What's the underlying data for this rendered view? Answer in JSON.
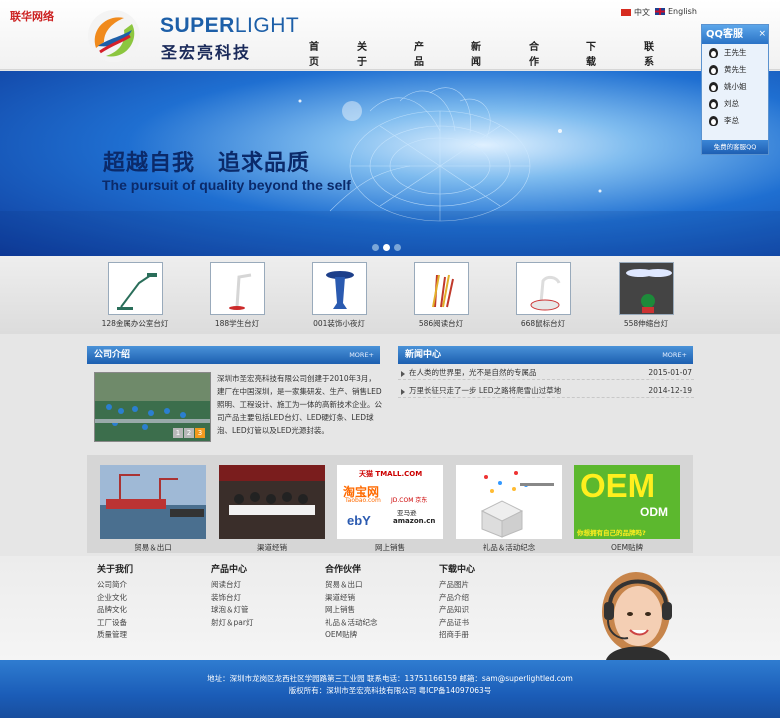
{
  "watermark": "联华网络",
  "brand": {
    "en_bold": "SUPER",
    "en_light": "LIGHT",
    "cn": "圣宏亮科技"
  },
  "lang": {
    "cn": "中文",
    "en": "English"
  },
  "nav": [
    "首页",
    "关于我们",
    "产品中心",
    "新闻中心",
    "合作伙伴",
    "下载中心",
    "联系我们"
  ],
  "banner": {
    "cn": "超越自我　追求品质",
    "en": "The pursuit of quality beyond the self"
  },
  "products": [
    {
      "caption": "128金属办公室台灯"
    },
    {
      "caption": "188学生台灯"
    },
    {
      "caption": "001装饰小夜灯"
    },
    {
      "caption": "586阅读台灯"
    },
    {
      "caption": "668鼠标台灯"
    },
    {
      "caption": "558伸缩台灯"
    }
  ],
  "about": {
    "title": "公司介绍",
    "more": "MORE+",
    "text": "深圳市圣宏亮科技有限公司创建于2010年3月，建厂在中国深圳，是一家集研发、生产、销售LED照明、工程设计、施工为一体的高新技术企业。公司产品主要包括LED台灯、LED硬灯条、LED球泡、LED灯管以及LED光源封装。",
    "pages": [
      "1",
      "2",
      "3"
    ]
  },
  "news": {
    "title": "新闻中心",
    "more": "MORE+",
    "items": [
      {
        "text": "在人类的世界里，光不是自然的专属品",
        "date": "2015-01-07"
      },
      {
        "text": "万里长征只走了一步 LED之路将爬雪山过草地",
        "date": "2014-12-19"
      }
    ]
  },
  "business": [
    {
      "caption": "贸易＆出口"
    },
    {
      "caption": "渠道经销"
    },
    {
      "caption": "网上销售",
      "logos": [
        "天猫 TMALL.COM",
        "淘宝网",
        "Taobao.com",
        "JD.COM 京东",
        "亚马逊",
        "amazon.cn",
        "ebY"
      ]
    },
    {
      "caption": "礼品＆活动纪念"
    },
    {
      "caption": "OEM贴牌",
      "oem": [
        "OEM",
        "ODM",
        "你想拥有自己的品牌吗?"
      ]
    }
  ],
  "footer_cols": [
    {
      "title": "关于我们",
      "links": [
        "公司简介",
        "企业文化",
        "品牌文化",
        "工厂设备",
        "质量管理"
      ]
    },
    {
      "title": "产品中心",
      "links": [
        "阅读台灯",
        "装饰台灯",
        "球泡＆灯管",
        "射灯＆par灯"
      ]
    },
    {
      "title": "合作伙伴",
      "links": [
        "贸易＆出口",
        "渠道经销",
        "网上销售",
        "礼品＆活动纪念",
        "OEM贴牌"
      ]
    },
    {
      "title": "下载中心",
      "links": [
        "产品图片",
        "产品介绍",
        "产品知识",
        "产品证书",
        "招商手册"
      ]
    }
  ],
  "footer": {
    "line1": "地址：深圳市龙岗区龙西社区学园路第三工业园  联系电话：13751166159  邮箱：sam@superlightled.com",
    "line2": "版权所有：深圳市圣宏亮科技有限公司    粤ICP备14097063号"
  },
  "qq": {
    "title": "QQ客服",
    "agents": [
      "王先生",
      "黄先生",
      "姚小姐",
      "刘总",
      "李总"
    ],
    "footer": "免费的客服QQ",
    "close": "×"
  },
  "colors": {
    "accent": "#1c5fb0",
    "nav_text": "#222222",
    "footer_bg": "#1b5db8"
  }
}
